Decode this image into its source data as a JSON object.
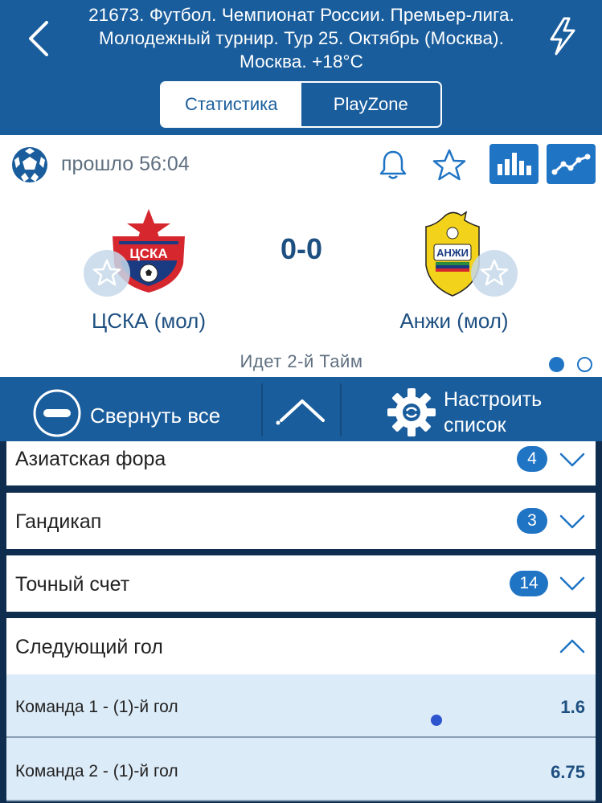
{
  "header": {
    "title": "21673. Футбол. Чемпионат России. Премьер-лига. Молодежный турнир. Тур 25. Октябрь (Москва). Москва. +18°C",
    "tabs": [
      {
        "label": "Статистика",
        "active": true
      },
      {
        "label": "PlayZone",
        "active": false
      }
    ]
  },
  "match": {
    "elapsed": "прошло 56:04",
    "score": "0-0",
    "home_team": "ЦСКА (мол)",
    "away_team": "Анжи (мол)",
    "period": "Идет 2-й  Тайм",
    "page_dots": 2,
    "active_dot": 1
  },
  "toolbar": {
    "collapse_label": "Свернуть все",
    "settings_label_line1": "Настроить",
    "settings_label_line2": "список"
  },
  "markets": [
    {
      "title": "Азиатская фора",
      "count": "4",
      "expanded": false
    },
    {
      "title": "Гандикап",
      "count": "3",
      "expanded": false
    },
    {
      "title": "Точный счет",
      "count": "14",
      "expanded": false
    },
    {
      "title": "Следующий гол",
      "count": "",
      "expanded": true
    }
  ],
  "outcomes": [
    {
      "label": "Команда 1 - (1)-й гол",
      "odds": "1.6"
    },
    {
      "label": "Команда 2 - (1)-й гол",
      "odds": "6.75"
    }
  ],
  "colors": {
    "primary": "#1a5d9c",
    "accent": "#1f74c4",
    "text_dark": "#1d4f80",
    "background": "#0f2d4f",
    "outcome_bg": "#dcebf8"
  },
  "icons": [
    "back-arrow-icon",
    "lightning-icon",
    "soccer-ball-icon",
    "bell-icon",
    "star-icon",
    "bar-chart-icon",
    "trend-line-icon",
    "minus-circle-icon",
    "chevron-up-icon",
    "gear-icon",
    "chevron-down-icon"
  ]
}
